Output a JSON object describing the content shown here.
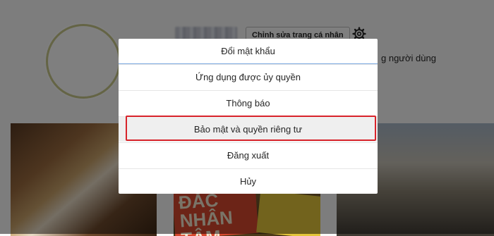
{
  "profile": {
    "edit_profile_label": "Chỉnh sửa trang cá nhân",
    "right_text": "g người dùng"
  },
  "photos": {
    "book_text": "ĐẮC NHÂN TÂM"
  },
  "dialog": {
    "items": [
      {
        "label": "Đổi mật khẩu"
      },
      {
        "label": "Ứng dụng được ủy quyền"
      },
      {
        "label": "Thông báo"
      },
      {
        "label": "Bảo mật và quyền riêng tư"
      },
      {
        "label": "Đăng xuất"
      },
      {
        "label": "Hủy"
      }
    ]
  },
  "colors": {
    "highlight_border": "#d8232a",
    "first_item_separator": "#7aa8e0"
  },
  "icons": {
    "settings": "gear-icon"
  }
}
